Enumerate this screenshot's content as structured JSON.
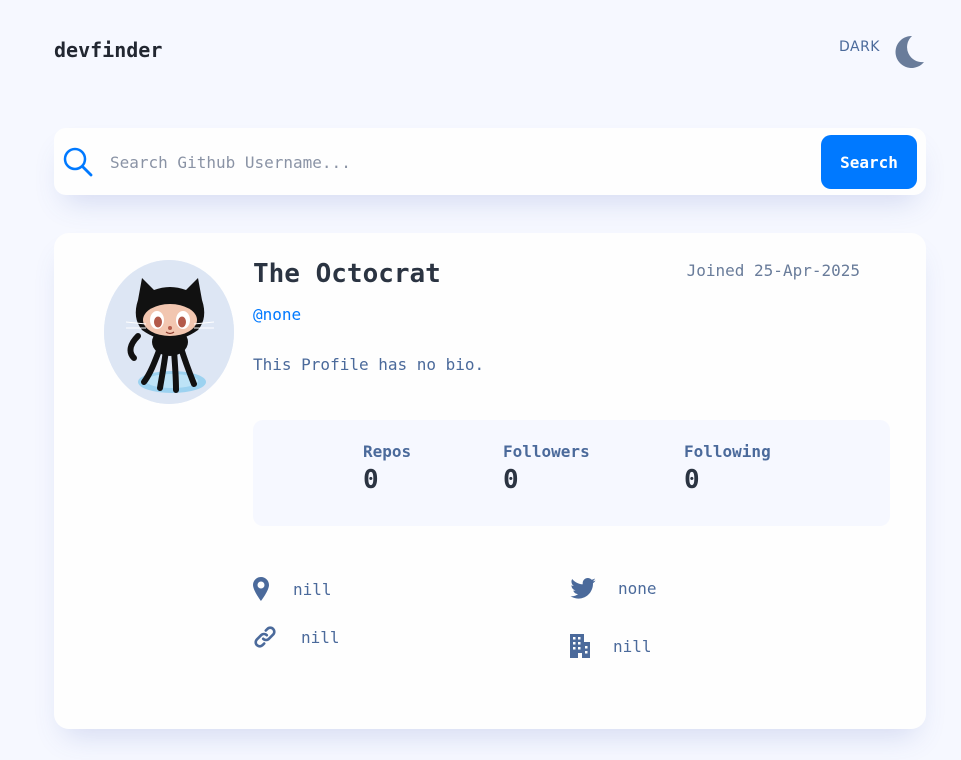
{
  "header": {
    "logo": "devfinder",
    "theme_label": "DARK",
    "theme_icon": "moon-icon"
  },
  "search": {
    "placeholder": "Search Github Username...",
    "value": "",
    "button_label": "Search",
    "icon": "search-icon"
  },
  "profile": {
    "name": "The Octocrat",
    "joined": "Joined 25-Apr-2025",
    "username": "@none",
    "bio": "This Profile has no bio.",
    "avatar_icon": "octocat-avatar",
    "stats": [
      {
        "label": "Repos",
        "value": "0"
      },
      {
        "label": "Followers",
        "value": "0"
      },
      {
        "label": "Following",
        "value": "0"
      }
    ],
    "links": {
      "location": {
        "icon": "location-pin-icon",
        "text": "nill"
      },
      "website": {
        "icon": "link-icon",
        "text": "nill"
      },
      "twitter": {
        "icon": "twitter-icon",
        "text": "none"
      },
      "company": {
        "icon": "building-icon",
        "text": "nill"
      }
    }
  },
  "colors": {
    "accent": "#0079ff",
    "background": "#f6f8ff",
    "card": "#fefefe",
    "text_dark": "#2b3442",
    "text_muted": "#4b6a9b"
  }
}
